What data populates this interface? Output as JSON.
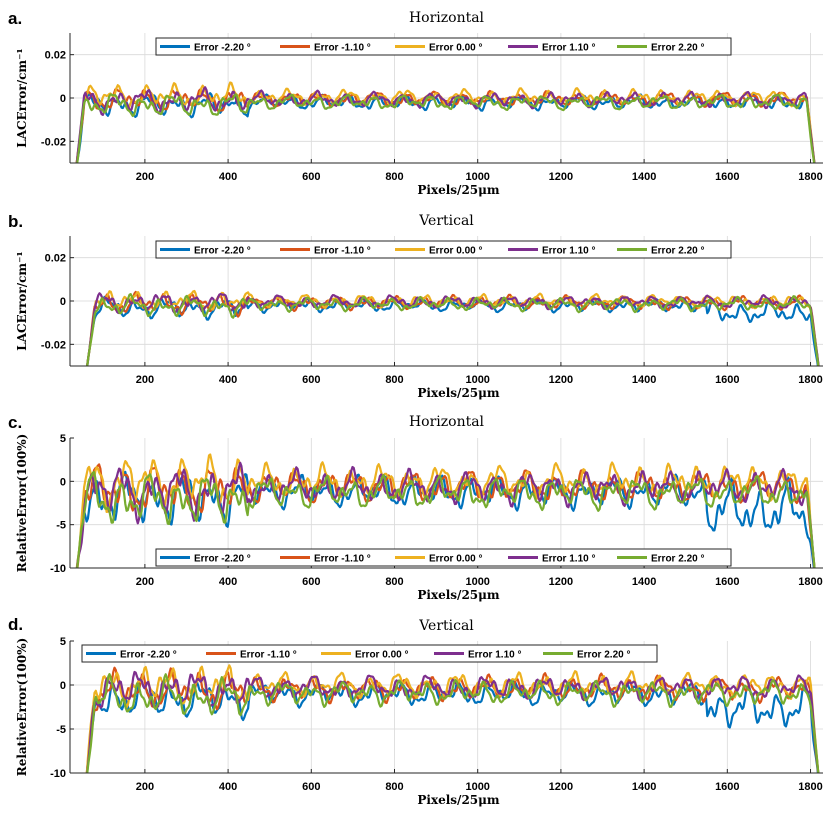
{
  "chart_data": [
    {
      "panel": "a.",
      "type": "line",
      "title": "Horizontal",
      "xlabel": "Pixels/25μm",
      "ylabel": "LACError/cm⁻¹",
      "xlim": [
        20,
        1830
      ],
      "ylim": [
        -0.03,
        0.03
      ],
      "xticks": [
        200,
        400,
        600,
        800,
        1000,
        1200,
        1400,
        1600,
        1800
      ],
      "yticks": [
        -0.02,
        0,
        0.02
      ],
      "ytick_labels": [
        "-0.02",
        "0",
        "0.02"
      ],
      "grid": true,
      "legend_position": "top",
      "x_range": [
        30,
        1815
      ],
      "noise_amplitude": 0.004,
      "series": [
        {
          "name": "Error -2.20 °",
          "color": "#0072BD",
          "offset": -0.002
        },
        {
          "name": "Error -1.10 °",
          "color": "#D95319",
          "offset": -0.0005
        },
        {
          "name": "Error 0.00 °",
          "color": "#EDB120",
          "offset": 0.0005
        },
        {
          "name": "Error 1.10 °",
          "color": "#7E2F8E",
          "offset": -0.0008
        },
        {
          "name": "Error 2.20 °",
          "color": "#77AC30",
          "offset": -0.002
        }
      ]
    },
    {
      "panel": "b.",
      "type": "line",
      "title": "Vertical",
      "xlabel": "Pixels/25μm",
      "ylabel": "LACError/cm⁻¹",
      "xlim": [
        20,
        1830
      ],
      "ylim": [
        -0.03,
        0.03
      ],
      "xticks": [
        200,
        400,
        600,
        800,
        1000,
        1200,
        1400,
        1600,
        1800
      ],
      "yticks": [
        -0.02,
        0,
        0.02
      ],
      "ytick_labels": [
        "-0.02",
        "0",
        "0.02"
      ],
      "grid": true,
      "legend_position": "top",
      "x_range": [
        55,
        1825
      ],
      "noise_amplitude": 0.0035,
      "series": [
        {
          "name": "Error -2.20 °",
          "color": "#0072BD",
          "offset": -0.002
        },
        {
          "name": "Error -1.10 °",
          "color": "#D95319",
          "offset": -0.0008
        },
        {
          "name": "Error 0.00 °",
          "color": "#EDB120",
          "offset": 0.0
        },
        {
          "name": "Error 1.10 °",
          "color": "#7E2F8E",
          "offset": -0.0005
        },
        {
          "name": "Error 2.20 °",
          "color": "#77AC30",
          "offset": -0.0015
        }
      ]
    },
    {
      "panel": "c.",
      "type": "line",
      "title": "Horizontal",
      "xlabel": "Pixels/25μm",
      "ylabel": "RelativeError(100%)",
      "xlim": [
        20,
        1830
      ],
      "ylim": [
        -10,
        5
      ],
      "xticks": [
        200,
        400,
        600,
        800,
        1000,
        1200,
        1400,
        1600,
        1800
      ],
      "yticks": [
        -10,
        -5,
        0,
        5
      ],
      "ytick_labels": [
        "-10",
        "-5",
        "0",
        "5"
      ],
      "grid": true,
      "legend_position": "bottom",
      "x_range": [
        30,
        1815
      ],
      "noise_amplitude": 2.2,
      "series": [
        {
          "name": "Error -2.20 °",
          "color": "#0072BD",
          "offset": -1.2
        },
        {
          "name": "Error -1.10 °",
          "color": "#D95319",
          "offset": -0.6
        },
        {
          "name": "Error 0.00 °",
          "color": "#EDB120",
          "offset": 0.0
        },
        {
          "name": "Error 1.10 °",
          "color": "#7E2F8E",
          "offset": -0.7
        },
        {
          "name": "Error 2.20 °",
          "color": "#77AC30",
          "offset": -1.3
        }
      ]
    },
    {
      "panel": "d.",
      "type": "line",
      "title": "Vertical",
      "xlabel": "Pixels/25μm",
      "ylabel": "RelativeError(100%)",
      "xlim": [
        20,
        1830
      ],
      "ylim": [
        -10,
        5
      ],
      "xticks": [
        200,
        400,
        600,
        800,
        1000,
        1200,
        1400,
        1600,
        1800
      ],
      "yticks": [
        -10,
        -5,
        0,
        5
      ],
      "ytick_labels": [
        "-10",
        "-5",
        "0",
        "5"
      ],
      "grid": true,
      "legend_position": "top-left",
      "x_range": [
        55,
        1825
      ],
      "noise_amplitude": 1.6,
      "series": [
        {
          "name": "Error -2.20 °",
          "color": "#0072BD",
          "offset": -1.0
        },
        {
          "name": "Error -1.10 °",
          "color": "#D95319",
          "offset": -0.4
        },
        {
          "name": "Error 0.00 °",
          "color": "#EDB120",
          "offset": 0.0
        },
        {
          "name": "Error 1.10 °",
          "color": "#7E2F8E",
          "offset": -0.3
        },
        {
          "name": "Error 2.20 °",
          "color": "#77AC30",
          "offset": -0.9
        }
      ]
    }
  ]
}
